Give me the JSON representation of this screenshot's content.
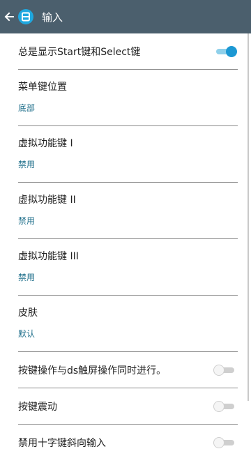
{
  "appbar": {
    "title": "输入",
    "logo_letter": "B",
    "back_icon": "back-arrow-icon",
    "background": "#4b5f6d",
    "logo_color": "#1fa8e0"
  },
  "settings": {
    "always_show_start_select": {
      "label": "总是显示Start键和Select键",
      "enabled": true
    },
    "menu_key_position": {
      "label": "菜单键位置",
      "value": "底部"
    },
    "virtual_key_1": {
      "label": "虚拟功能键 I",
      "value": "禁用"
    },
    "virtual_key_2": {
      "label": "虚拟功能键 II",
      "value": "禁用"
    },
    "virtual_key_3": {
      "label": "虚拟功能键 III",
      "value": "禁用"
    },
    "skin": {
      "label": "皮肤",
      "value": "默认"
    },
    "simultaneous_touch": {
      "label": "按键操作与ds触屏操作同时进行。",
      "enabled": false
    },
    "key_vibration": {
      "label": "按键震动",
      "enabled": false
    },
    "disable_diagonal_dpad": {
      "label": "禁用十字键斜向输入",
      "enabled": false
    }
  },
  "colors": {
    "accent": "#1c98d3",
    "subtitle": "#1f6f8b",
    "divider": "#8a8a8a"
  }
}
